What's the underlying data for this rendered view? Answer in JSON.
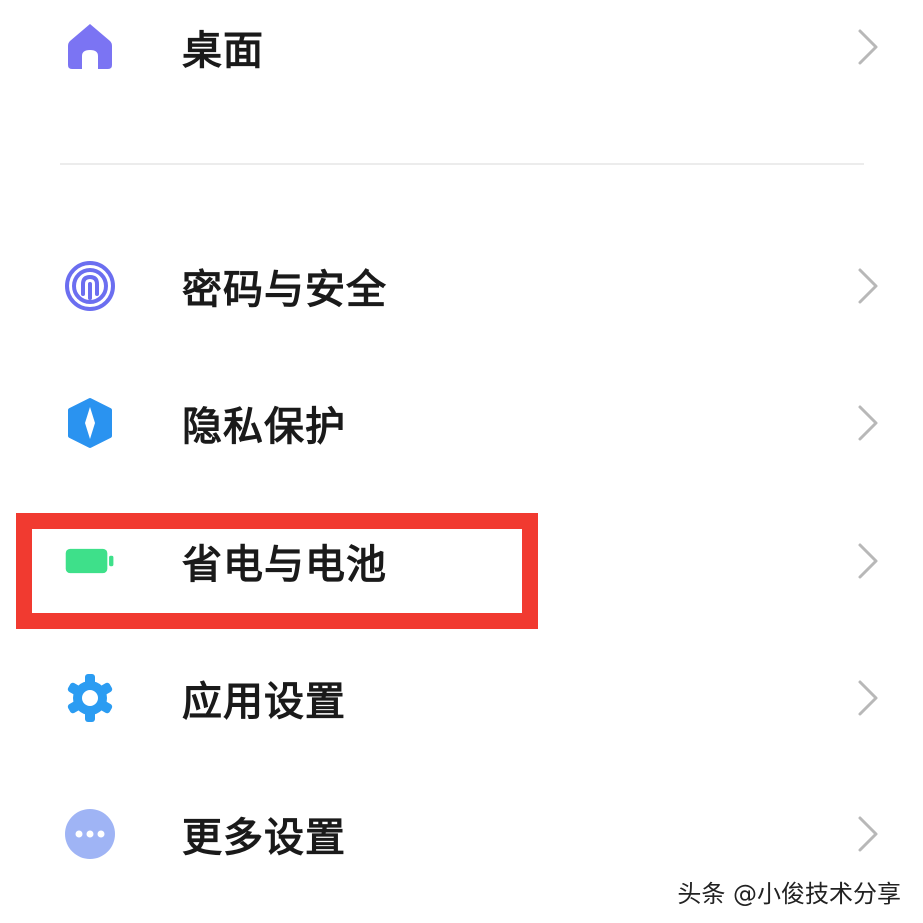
{
  "settings_items": [
    {
      "label": "桌面",
      "icon": "home-icon",
      "color": "#7b74f3"
    },
    {
      "label": "密码与安全",
      "icon": "fingerprint-icon",
      "color": "#6b6ef0"
    },
    {
      "label": "隐私保护",
      "icon": "privacy-shield-icon",
      "color": "#2a93f0"
    },
    {
      "label": "省电与电池",
      "icon": "battery-icon",
      "color": "#3ee08a"
    },
    {
      "label": "应用设置",
      "icon": "gear-icon",
      "color": "#2b9cf2"
    },
    {
      "label": "更多设置",
      "icon": "more-dots-icon",
      "color": "#9fb4f5"
    }
  ],
  "highlight": {
    "item": "省电与电池",
    "color": "#f13a30"
  },
  "watermark": "头条 @小俊技术分享"
}
